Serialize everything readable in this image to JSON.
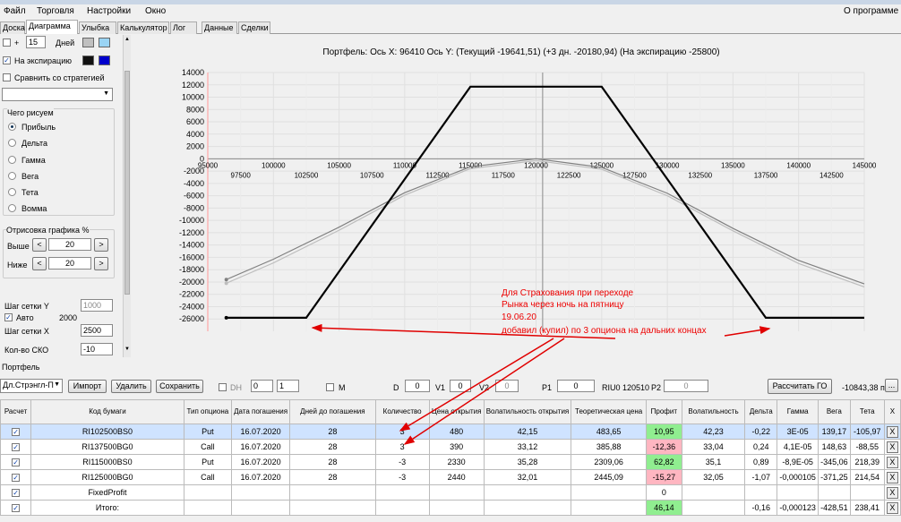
{
  "menu": {
    "file": "Файл",
    "trade": "Торговля",
    "settings": "Настройки",
    "window": "Окно",
    "about": "О программе"
  },
  "tabs": [
    "Доска",
    "Диаграмма",
    "Улыбка",
    "Калькулятор",
    "Лог",
    "Данные",
    "Сделки"
  ],
  "left": {
    "plus_label": "+",
    "days_value": "15",
    "days_label": "Дней",
    "expiry_label": "На экспирацию",
    "compare_label": "Сравнить со стратегией",
    "draw_group": "Чего рисуем",
    "options": [
      "Прибыль",
      "Дельта",
      "Гамма",
      "Вега",
      "Тета",
      "Вомма"
    ],
    "render_group": "Отрисовка графика %",
    "above_label": "Выше",
    "above_value": "20",
    "below_label": "Ниже",
    "below_value": "20",
    "grid_y_label": "Шаг сетки Y",
    "grid_y_value": "1000",
    "auto_label": "Авто",
    "auto_value": "2000",
    "grid_x_label": "Шаг сетки X",
    "grid_x_value": "2500",
    "sko_label": "Кол-во СКО",
    "sko_value": "-10",
    "lt": "<",
    "gt": ">"
  },
  "colors": {
    "current": "#999999",
    "expiry": "#000000",
    "plus_swatch": "#c0c0c0",
    "plus_swatch2": "#9ad4f4",
    "exp_swatch": "#111111",
    "exp_swatch2": "#0000cc",
    "annotation": "#e00000"
  },
  "chart_data": {
    "type": "line",
    "title": "Портфель: Ось X: 96410 Ось Y:  (Текущий -19641,51)  (+3 дн. -20180,94)  (На экспирацию -25800)",
    "xlim": [
      95000,
      145000
    ],
    "ylim": [
      -28000,
      14000
    ],
    "y_ticks": [
      14000,
      12000,
      10000,
      8000,
      6000,
      4000,
      2000,
      0,
      -2000,
      -4000,
      -6000,
      -8000,
      -10000,
      -12000,
      -14000,
      -16000,
      -18000,
      -20000,
      -22000,
      -24000,
      -26000
    ],
    "x_ticks_top": [
      95000,
      100000,
      105000,
      110000,
      115000,
      120000,
      125000,
      130000,
      135000,
      140000,
      145000
    ],
    "x_ticks_bottom": [
      97500,
      102500,
      107500,
      112500,
      117500,
      122500,
      127500,
      132500,
      137500,
      142500
    ],
    "cursor_x": 120500,
    "expiry": {
      "x": [
        96410,
        102500,
        115000,
        125000,
        137500,
        145000
      ],
      "y": [
        -25800,
        -25800,
        11700,
        11700,
        -25800,
        -25800
      ]
    },
    "current": {
      "x": [
        96410,
        100000,
        105000,
        110000,
        115000,
        120000,
        125000,
        130000,
        135000,
        140000,
        145000
      ],
      "y": [
        -19600,
        -16300,
        -11100,
        -5500,
        -1300,
        0,
        -1400,
        -5600,
        -11300,
        -16500,
        -20300
      ]
    },
    "plus3": {
      "x": [
        96410,
        100000,
        105000,
        110000,
        115000,
        120000,
        125000,
        130000,
        135000,
        140000,
        145000
      ],
      "y": [
        -20200,
        -16900,
        -11600,
        -5900,
        -1600,
        -300,
        -1700,
        -6000,
        -11700,
        -17000,
        -20800
      ]
    }
  },
  "annotation": {
    "line1": "Для Страхования при переходе",
    "line2": "Рынка через ночь на пятницу",
    "line3": " 19.06.20",
    "line4": "добавил (купил) по 3 опциона на дальних концах"
  },
  "portfolio": {
    "label": "Портфель",
    "strategy": "Дл.Стрэнгл-П",
    "import": "Импорт",
    "delete": "Удалить",
    "save": "Сохранить",
    "dh": "DH",
    "dh_a": "0",
    "dh_b": "1",
    "m": "M",
    "d_label": "D",
    "d_value": "0",
    "v1_label": "V1",
    "v1_value": "0",
    "v2_label": "V2",
    "v2_value": "0",
    "p1_label": "P1",
    "p1_value": "0",
    "riu": "RIU0 120510",
    "p2_label": "P2",
    "p2_value": "0",
    "calc_go": "Рассчитать ГО",
    "total": "-10843,38 п",
    "dots": "..."
  },
  "table": {
    "headers": [
      "Расчет",
      "Код бумаги",
      "Тип опциона",
      "Дата погашения",
      "Дней до погашения",
      "Количество",
      "Цена открытия",
      "Волатильность открытия",
      "Теоретическая цена",
      "Профит",
      "Волатильность",
      "Дельта",
      "Гамма",
      "Вега",
      "Тета",
      "X"
    ],
    "rows": [
      [
        "RI102500BS0",
        "Put",
        "16.07.2020",
        "28",
        "3",
        "480",
        "42,15",
        "483,65",
        "10,95",
        "42,23",
        "-0,22",
        "3E-05",
        "139,17",
        "-105,97"
      ],
      [
        "RI137500BG0",
        "Call",
        "16.07.2020",
        "28",
        "3",
        "390",
        "33,12",
        "385,88",
        "-12,36",
        "33,04",
        "0,24",
        "4,1E-05",
        "148,63",
        "-88,55"
      ],
      [
        "RI115000BS0",
        "Put",
        "16.07.2020",
        "28",
        "-3",
        "2330",
        "35,28",
        "2309,06",
        "62,82",
        "35,1",
        "0,89",
        "-8,9E-05",
        "-345,06",
        "218,39"
      ],
      [
        "RI125000BG0",
        "Call",
        "16.07.2020",
        "28",
        "-3",
        "2440",
        "32,01",
        "2445,09",
        "-15,27",
        "32,05",
        "-1,07",
        "-0,000105",
        "-371,25",
        "214,54"
      ]
    ],
    "fixed": {
      "name": "FixedProfit",
      "profit": "0"
    },
    "total": {
      "name": "Итого:",
      "profit": "46,14",
      "delta": "-0,16",
      "gamma": "-0,000123",
      "vega": "-428,51",
      "theta": "238,41"
    },
    "x": "X",
    "check": "✓"
  }
}
